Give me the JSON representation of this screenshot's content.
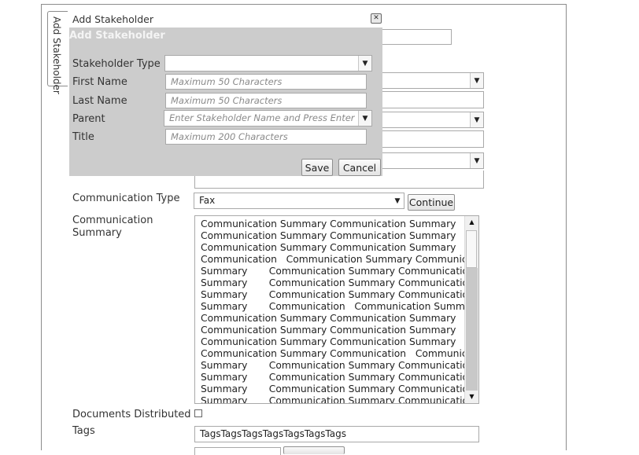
{
  "side_tab": {
    "label": "Add Stakeholder"
  },
  "modal": {
    "title": "Add Stakeholder",
    "heading": "Add Stakeholder",
    "fields": {
      "stakeholder_type": {
        "label": "Stakeholder Type",
        "value": ""
      },
      "first_name": {
        "label": "First Name",
        "placeholder": "Maximum 50 Characters"
      },
      "last_name": {
        "label": "Last Name",
        "placeholder": "Maximum 50 Characters"
      },
      "parent": {
        "label": "Parent",
        "placeholder": "Enter Stakeholder Name and Press Enter"
      },
      "title": {
        "label": "Title",
        "placeholder": "Maximum 200 Characters"
      }
    },
    "save_label": "Save",
    "cancel_label": "Cancel"
  },
  "form": {
    "communication_type": {
      "label": "Communication Type",
      "value": "Fax",
      "continue_label": "Continue"
    },
    "communication_summary": {
      "label": "Communication Summary",
      "lines": [
        "Communication Summary Communication Summary",
        "Communication Summary Communication Summary",
        "Communication Summary Communication Summary",
        "Communication   Communication Summary Communication",
        "Summary       Communication Summary Communication",
        "Summary       Communication Summary Communication",
        "Summary       Communication Summary Communication",
        "Summary       Communication   Communication Summary",
        "Communication Summary Communication Summary",
        "Communication Summary Communication Summary",
        "Communication Summary Communication Summary",
        "Communication Summary Communication   Communication",
        "Summary       Communication Summary Communication",
        "Summary       Communication Summary Communication",
        "Summary       Communication Summary Communication",
        "Summary       Communication Summary Communication"
      ]
    },
    "documents_distributed": {
      "label": "Documents Distributed",
      "checked": false
    },
    "tags": {
      "label": "Tags",
      "value": "TagsTagsTagsTagsTagsTagsTags"
    }
  },
  "icons": {
    "close": "close-icon",
    "dropdown": "chevron-down-icon"
  }
}
